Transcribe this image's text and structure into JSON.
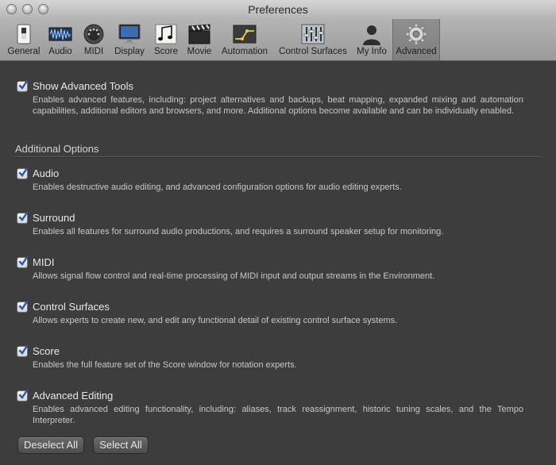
{
  "window": {
    "title": "Preferences"
  },
  "toolbar": {
    "items": [
      {
        "label": "General",
        "icon": "general-switch-icon"
      },
      {
        "label": "Audio",
        "icon": "audio-waveform-icon"
      },
      {
        "label": "MIDI",
        "icon": "midi-connector-icon"
      },
      {
        "label": "Display",
        "icon": "monitor-icon"
      },
      {
        "label": "Score",
        "icon": "music-notes-icon"
      },
      {
        "label": "Movie",
        "icon": "clapperboard-icon"
      },
      {
        "label": "Automation",
        "icon": "automation-curve-icon"
      },
      {
        "label": "Control Surfaces",
        "icon": "faders-icon"
      },
      {
        "label": "My Info",
        "icon": "person-silhouette-icon"
      },
      {
        "label": "Advanced",
        "icon": "gear-icon"
      }
    ],
    "selected": "Advanced"
  },
  "main": {
    "show_advanced": {
      "label": "Show Advanced Tools",
      "checked": true,
      "description": "Enables advanced features, including: project alternatives and backups, beat mapping, expanded mixing and automation capabilities, additional editors and browsers, and more. Additional options become available and can be individually enabled."
    },
    "section_title": "Additional Options",
    "options": [
      {
        "label": "Audio",
        "checked": true,
        "description": "Enables destructive audio editing, and advanced configuration options for audio editing experts."
      },
      {
        "label": "Surround",
        "checked": true,
        "description": "Enables all features for surround audio productions, and requires a surround speaker setup for monitoring."
      },
      {
        "label": "MIDI",
        "checked": true,
        "description": "Allows signal flow control and real-time processing of MIDI input and output streams in the Environment."
      },
      {
        "label": "Control Surfaces",
        "checked": true,
        "description": "Allows experts to create new, and edit any functional detail of existing control surface systems."
      },
      {
        "label": "Score",
        "checked": true,
        "description": "Enables the full feature set of the Score window for notation experts."
      },
      {
        "label": "Advanced Editing",
        "checked": true,
        "description": "Enables advanced editing functionality, including: aliases, track reassignment, historic tuning scales, and the Tempo Interpreter."
      }
    ]
  },
  "buttons": {
    "deselect_all": "Deselect All",
    "select_all": "Select All"
  }
}
